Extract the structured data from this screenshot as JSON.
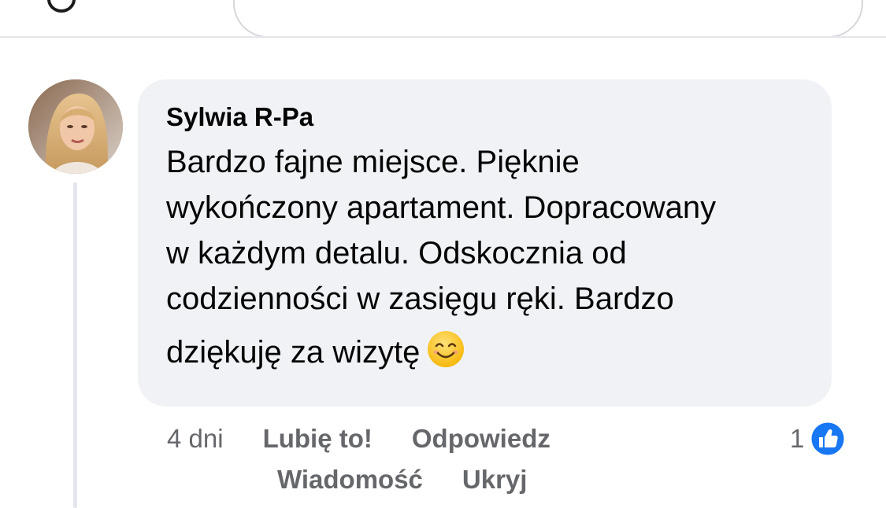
{
  "comment": {
    "author": "Sylwia R-Pa",
    "text_lines": [
      "Bardzo fajne miejsce. Pięknie",
      "wykończony apartament. Dopracowany",
      "w każdym detalu. Odskocznia od",
      "codzienności w zasięgu ręki. Bardzo",
      "dziękuję za wizytę"
    ],
    "emoji": "smiling-face-icon",
    "time": "4 dni",
    "actions": {
      "like": "Lubię to!",
      "reply": "Odpowiedz",
      "message": "Wiadomość",
      "hide": "Ukryj"
    },
    "reactions": {
      "count": "1",
      "icon": "thumbs-up-icon",
      "color": "#1877f2"
    }
  },
  "colors": {
    "bubble": "#f0f2f5",
    "secondary_text": "#65676b",
    "primary_text": "#050505"
  }
}
